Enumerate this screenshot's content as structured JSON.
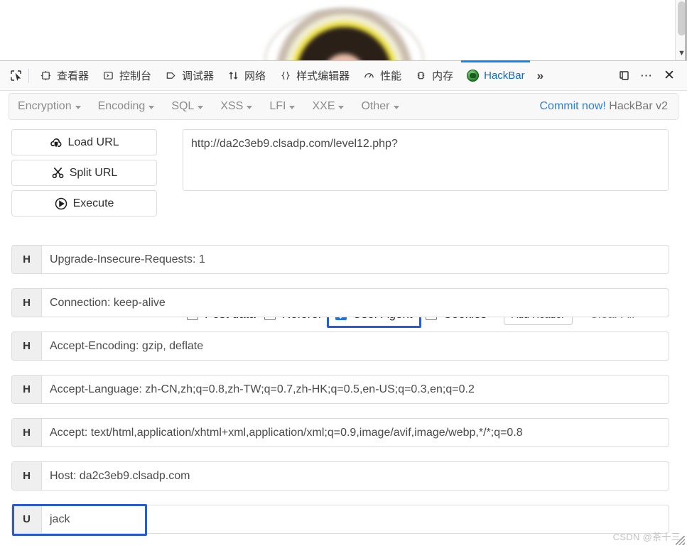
{
  "page_content": {
    "scrollbar": {
      "arrow_icon": "chevron-down-icon"
    }
  },
  "devtools": {
    "picker_icon": "element-picker-icon",
    "tabs": [
      {
        "label": "查看器",
        "icon": "inspector-icon",
        "active": false
      },
      {
        "label": "控制台",
        "icon": "console-icon",
        "active": false
      },
      {
        "label": "调试器",
        "icon": "debugger-icon",
        "active": false
      },
      {
        "label": "网络",
        "icon": "network-icon",
        "active": false
      },
      {
        "label": "样式编辑器",
        "icon": "style-editor-icon",
        "active": false
      },
      {
        "label": "性能",
        "icon": "performance-icon",
        "active": false
      },
      {
        "label": "内存",
        "icon": "memory-icon",
        "active": false
      },
      {
        "label": "HackBar",
        "icon": "hackbar-icon",
        "active": true
      }
    ],
    "overflow_label": "»",
    "dock_icon": "dock-split-icon",
    "meatball_icon": "more-options-icon",
    "close_icon": "close-icon",
    "active_tab_color": "#0a84ff"
  },
  "hackbar": {
    "menu": [
      {
        "label": "Encryption"
      },
      {
        "label": "Encoding"
      },
      {
        "label": "SQL"
      },
      {
        "label": "XSS"
      },
      {
        "label": "LFI"
      },
      {
        "label": "XXE"
      },
      {
        "label": "Other"
      }
    ],
    "commit": {
      "link_text": "Commit now!",
      "version_text": "HackBar v2",
      "link_color": "#2f7fd6"
    },
    "actions": [
      {
        "label": "Load URL",
        "icon": "cloud-download-icon"
      },
      {
        "label": "Split URL",
        "icon": "scissors-icon"
      },
      {
        "label": "Execute",
        "icon": "play-circle-icon"
      }
    ],
    "url": {
      "value": "http://da2c3eb9.clsadp.com/level12.php?",
      "placeholder": "URL"
    },
    "options": [
      {
        "label": "Post data",
        "checked": false,
        "focused": false
      },
      {
        "label": "Referer",
        "checked": false,
        "focused": false
      },
      {
        "label": "User Agent",
        "checked": true,
        "focused": true
      },
      {
        "label": "Cookies",
        "checked": false,
        "focused": false
      }
    ],
    "add_header_label": "Add Header",
    "clear_all_label": "Clear All",
    "headers": [
      {
        "tag": "H",
        "value": "Upgrade-Insecure-Requests: 1",
        "focused": false
      },
      {
        "tag": "H",
        "value": "Connection: keep-alive",
        "focused": false
      },
      {
        "tag": "H",
        "value": "Accept-Encoding: gzip, deflate",
        "focused": false
      },
      {
        "tag": "H",
        "value": "Accept-Language: zh-CN,zh;q=0.8,zh-TW;q=0.7,zh-HK;q=0.5,en-US;q=0.3,en;q=0.2",
        "focused": false
      },
      {
        "tag": "H",
        "value": "Accept: text/html,application/xhtml+xml,application/xml;q=0.9,image/avif,image/webp,*/*;q=0.8",
        "focused": false
      },
      {
        "tag": "H",
        "value": "Host: da2c3eb9.clsadp.com",
        "focused": false
      },
      {
        "tag": "U",
        "value": "jack",
        "focused": true
      }
    ]
  },
  "watermark": {
    "text": "CSDN @茶十三"
  }
}
